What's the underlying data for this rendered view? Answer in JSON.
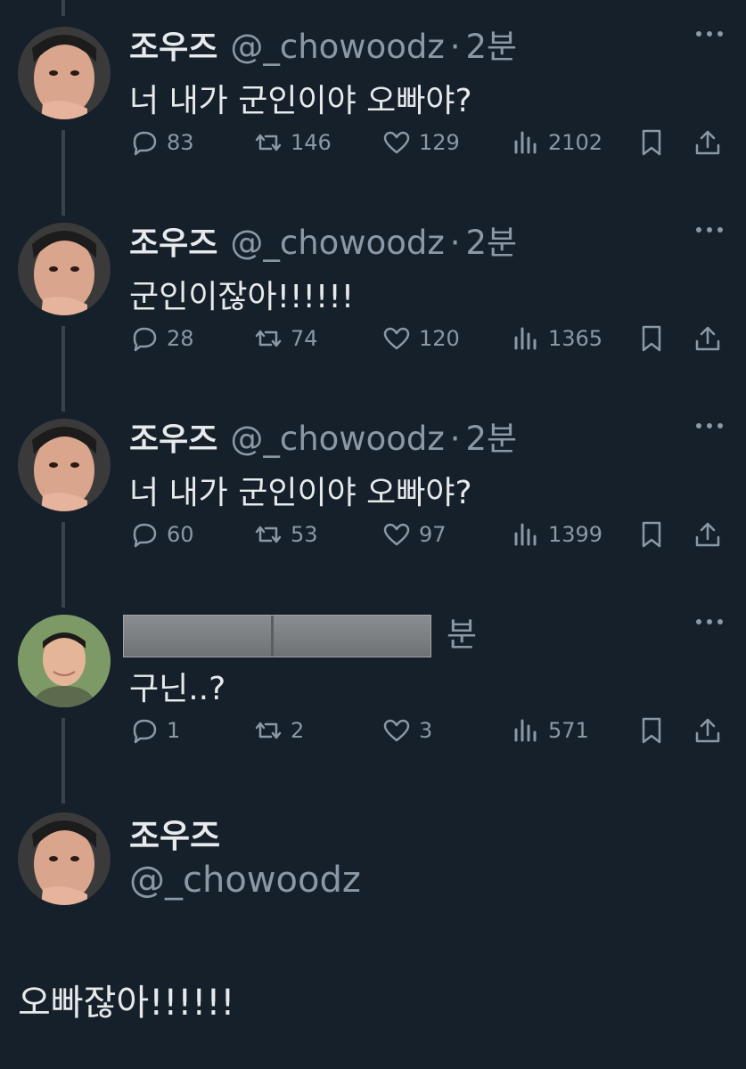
{
  "tweets": [
    {
      "name": "조우즈",
      "handle": "@_chowoodz",
      "dot": "·",
      "time": "2분",
      "text": "너 내가 군인이야 오빠야?",
      "stats": {
        "replies": "83",
        "retweets": "146",
        "likes": "129",
        "views": "2102"
      }
    },
    {
      "name": "조우즈",
      "handle": "@_chowoodz",
      "dot": "·",
      "time": "2분",
      "text": "군인이잖아!!!!!!",
      "stats": {
        "replies": "28",
        "retweets": "74",
        "likes": "120",
        "views": "1365"
      }
    },
    {
      "name": "조우즈",
      "handle": "@_chowoodz",
      "dot": "·",
      "time": "2분",
      "text": "너 내가 군인이야 오빠야?",
      "stats": {
        "replies": "60",
        "retweets": "53",
        "likes": "97",
        "views": "1399"
      }
    },
    {
      "name": "",
      "handle": "",
      "dot": "",
      "time": "분",
      "text": "구닌..?",
      "stats": {
        "replies": "1",
        "retweets": "2",
        "likes": "3",
        "views": "571"
      }
    }
  ],
  "main_tweet": {
    "name": "조우즈",
    "handle": "@_chowoodz",
    "text": "오빠잖아!!!!!!"
  },
  "colors": {
    "background": "#15202b",
    "text": "#e7e9ea",
    "secondary": "#8b98a5",
    "thread_line": "#38444d"
  },
  "icons": [
    "reply-icon",
    "retweet-icon",
    "like-icon",
    "views-icon",
    "bookmark-icon",
    "share-icon",
    "more-icon"
  ]
}
